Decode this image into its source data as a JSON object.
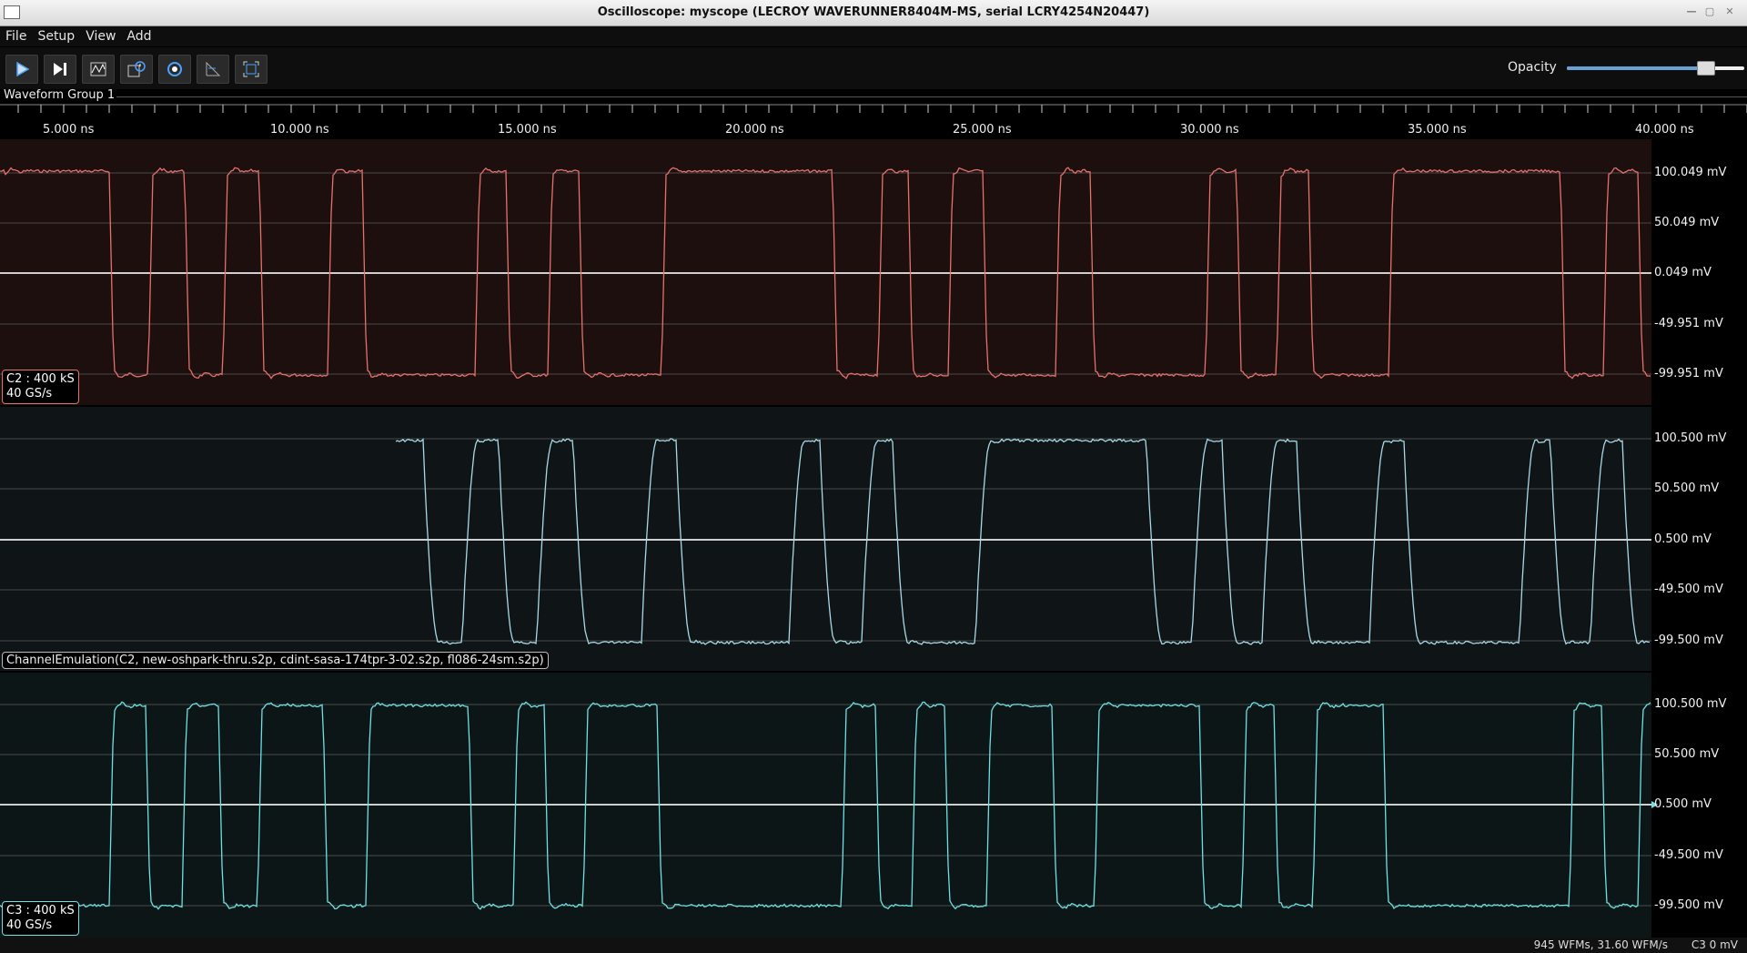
{
  "window": {
    "title": "Oscilloscope: myscope (LECROY WAVERUNNER8404M-MS, serial LCRY4254N20447)"
  },
  "menu": [
    "File",
    "Setup",
    "View",
    "Add"
  ],
  "toolbar": {
    "buttons": [
      "play-icon",
      "single-step-icon",
      "waveform-icon",
      "history-icon",
      "config-icon",
      "measure-icon",
      "fullscreen-icon"
    ],
    "opacity_label": "Opacity",
    "opacity_value": 0.78
  },
  "group": {
    "label": "Waveform Group 1"
  },
  "timeline": {
    "labels": [
      "5.000 ns",
      "10.000 ns",
      "15.000 ns",
      "20.000 ns",
      "25.000 ns",
      "30.000 ns",
      "35.000 ns",
      "40.000 ns"
    ]
  },
  "panels": [
    {
      "y_labels": [
        "100.049 mV",
        "50.049 mV",
        "0.049 mV",
        "-49.951 mV",
        "-99.951 mV"
      ],
      "trace_label": "C2 : 400 kS\n40 GS/s",
      "trace_line1": "C2 : 400 kS",
      "trace_line2": "40 GS/s",
      "color": "#e3716d",
      "bg": "#1d0f0e"
    },
    {
      "y_labels": [
        "100.500 mV",
        "50.500 mV",
        "0.500 mV",
        "-49.500 mV",
        "-99.500 mV"
      ],
      "filter_label": "ChannelEmulation(C2, new-oshpark-thru.s2p, cdint-sasa-174tpr-3-02.s2p, fl086-24sm.s2p)",
      "color": "#a9d9e6",
      "bg": "#0f1416"
    },
    {
      "y_labels": [
        "100.500 mV",
        "50.500 mV",
        "0.500 mV",
        "-49.500 mV",
        "-99.500 mV"
      ],
      "trace_line1": "C3 : 400 kS",
      "trace_line2": "40 GS/s",
      "color": "#6fe0e3",
      "bg": "#0c1617"
    }
  ],
  "status": {
    "wfm_count": "945 WFMs, 31.60 WFM/s",
    "cursor": "C3 0 mV"
  }
}
